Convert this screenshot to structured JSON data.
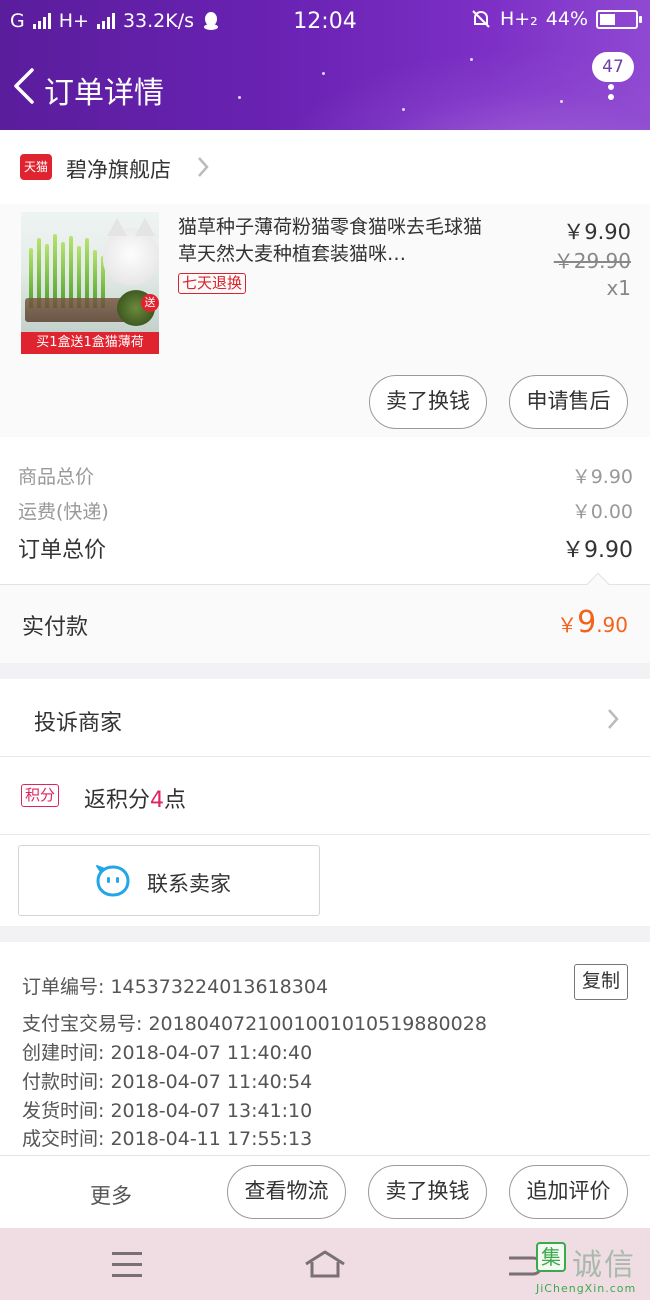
{
  "status_bar": {
    "carrier1": "G",
    "carrier2": "H+",
    "speed": "33.2K/s",
    "time": "12:04",
    "network": "H+₂",
    "battery_text": "44%",
    "battery_level": 0.44
  },
  "header": {
    "title": "订单详情",
    "message_count": "47"
  },
  "store": {
    "badge": "天猫",
    "name": "碧净旗舰店"
  },
  "product": {
    "title": "猫草种子薄荷粉猫零食猫咪去毛球猫草天然大麦种植套装猫咪…",
    "promo_text": "买1盒送1盒猫薄荷",
    "gift_tag": "送",
    "return_badge": "七天退换",
    "price": "￥9.90",
    "original_price": "￥29.90",
    "quantity": "x1",
    "btn_sell": "卖了换钱",
    "btn_after_sale": "申请售后"
  },
  "summary": {
    "goods_label": "商品总价",
    "goods_value": "￥9.90",
    "shipping_label": "运费(快递)",
    "shipping_value": "￥0.00",
    "total_label": "订单总价",
    "total_value": "￥9.90"
  },
  "paid": {
    "label": "实付款",
    "currency": "￥",
    "integer": "9",
    "decimal": ".90"
  },
  "complain": {
    "label": "投诉商家"
  },
  "points": {
    "badge": "积分",
    "prefix": "返积分",
    "count": "4",
    "suffix": "点"
  },
  "contact": {
    "label": "联系卖家"
  },
  "order_info": {
    "order_no": "订单编号: 145373224013618304",
    "copy_label": "复制",
    "alipay_no": "支付宝交易号: 2018040721001001010519880028",
    "created": "创建时间:  2018-04-07 11:40:40",
    "paid": "付款时间:  2018-04-07 11:40:54",
    "shipped": "发货时间:  2018-04-07 13:41:10",
    "completed": "成交时间:  2018-04-11 17:55:13"
  },
  "action_bar": {
    "more": "更多",
    "logistics": "查看物流",
    "sell": "卖了换钱",
    "review": "追加评价"
  },
  "watermark": {
    "logo": "集",
    "brand": "诚信",
    "url": "JiChengXin.com"
  },
  "colors": {
    "header_purple": "#6a23b4",
    "price_orange": "#f2631c",
    "tmall_red": "#e0242f",
    "points_pink": "#e0245e"
  }
}
